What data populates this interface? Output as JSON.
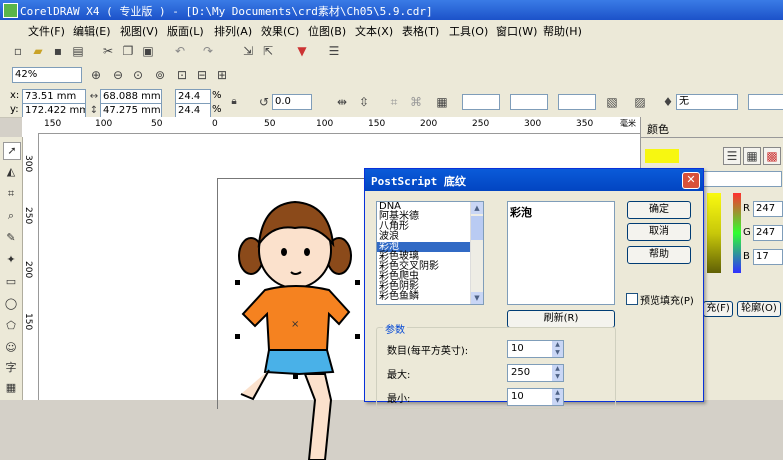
{
  "window": {
    "title": "CorelDRAW X4 ( 专业版 ) - [D:\\My Documents\\crd素材\\Ch05\\5.9.cdr]"
  },
  "menu": [
    "文件(F)",
    "编辑(E)",
    "视图(V)",
    "版面(L)",
    "排列(A)",
    "效果(C)",
    "位图(B)",
    "文本(X)",
    "表格(T)",
    "工具(O)",
    "窗口(W)",
    "帮助(H)"
  ],
  "zoom": {
    "value": "42%"
  },
  "property_bar": {
    "x_label": "x:",
    "x_value": "73.51 mm",
    "y_label": "y:",
    "y_value": "172.422 mm",
    "w_value": "68.088 mm",
    "h_value": "47.275 mm",
    "scale_w": "24.4",
    "scale_h": "24.4",
    "percent": "%",
    "rotation": "0.0",
    "outline": "无"
  },
  "ruler_h": [
    "150",
    "100",
    "50",
    "0",
    "50",
    "100",
    "150",
    "200",
    "250",
    "300",
    "350",
    "400"
  ],
  "ruler_v": [
    "300",
    "250",
    "200",
    "150"
  ],
  "ruler_unit": "毫米",
  "docker": {
    "title": "颜色",
    "channels": [
      {
        "label": "R",
        "value": "247"
      },
      {
        "label": "G",
        "value": "247"
      },
      {
        "label": "B",
        "value": "17"
      }
    ],
    "btn_fill_partial": "充(F)",
    "btn_outline": "轮廓(O)"
  },
  "dialog": {
    "title": "PostScript 底纹",
    "textures": [
      "DNA",
      "阿基米德",
      "八角形",
      "波浪",
      "彩泡",
      "彩色玻璃",
      "彩色交叉阴影",
      "彩色爬虫",
      "彩色阴影",
      "彩色鱼鳞"
    ],
    "selected_index": 4,
    "preview_label": "彩泡",
    "ok": "确定",
    "cancel": "取消",
    "help": "帮助",
    "preview_checkbox": "预览填充(P)",
    "refresh": "刷新(R)",
    "params_group": "参数",
    "params": [
      {
        "label": "数目(每平方英寸):",
        "value": "10"
      },
      {
        "label": "最大:",
        "value": "250"
      },
      {
        "label": "最小:",
        "value": "10"
      }
    ]
  },
  "colors": {
    "title_bar": "#1c52c9",
    "selected_list": "#316ac5",
    "swatch_yellow": "#f7f711",
    "shirt": "#f58220"
  }
}
